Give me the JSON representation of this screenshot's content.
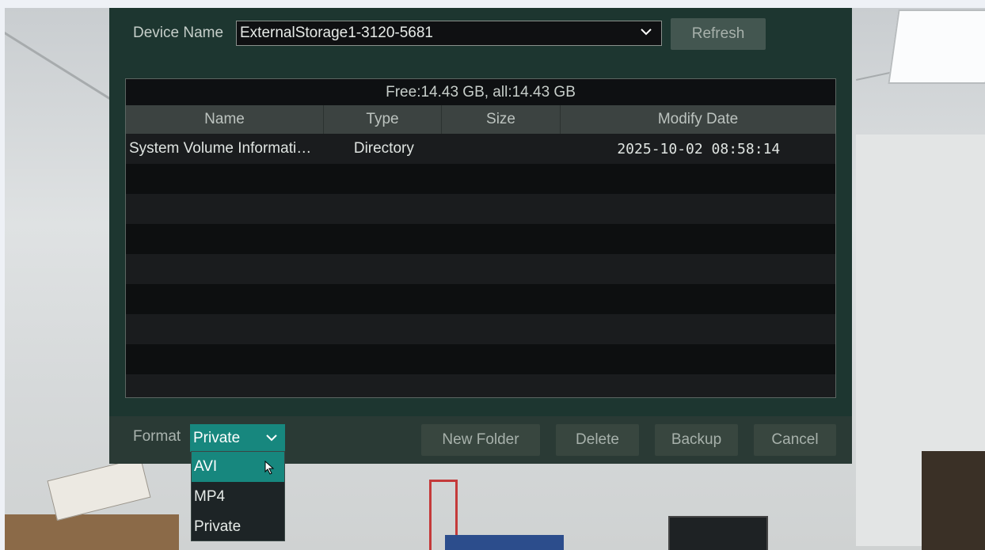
{
  "top": {
    "device_name_label": "Device Name",
    "device_name_value": "ExternalStorage1-3120-5681",
    "refresh_label": "Refresh"
  },
  "table": {
    "free_text": "Free:14.43 GB, all:14.43 GB",
    "headers": [
      "Name",
      "Type",
      "Size",
      "Modify Date"
    ],
    "rows": [
      {
        "name": "System Volume Informati…",
        "type": "Directory",
        "size": "",
        "date": "2025-10-02 08:58:14"
      }
    ]
  },
  "bottom": {
    "format_label": "Format",
    "format_value": "Private",
    "new_folder_label": "New Folder",
    "delete_label": "Delete",
    "backup_label": "Backup",
    "cancel_label": "Cancel"
  },
  "format_options": [
    "AVI",
    "MP4",
    "Private"
  ],
  "colors": {
    "accent": "#17877e",
    "dialog_bg": "#1d3630",
    "button_bg": "#38463f"
  }
}
